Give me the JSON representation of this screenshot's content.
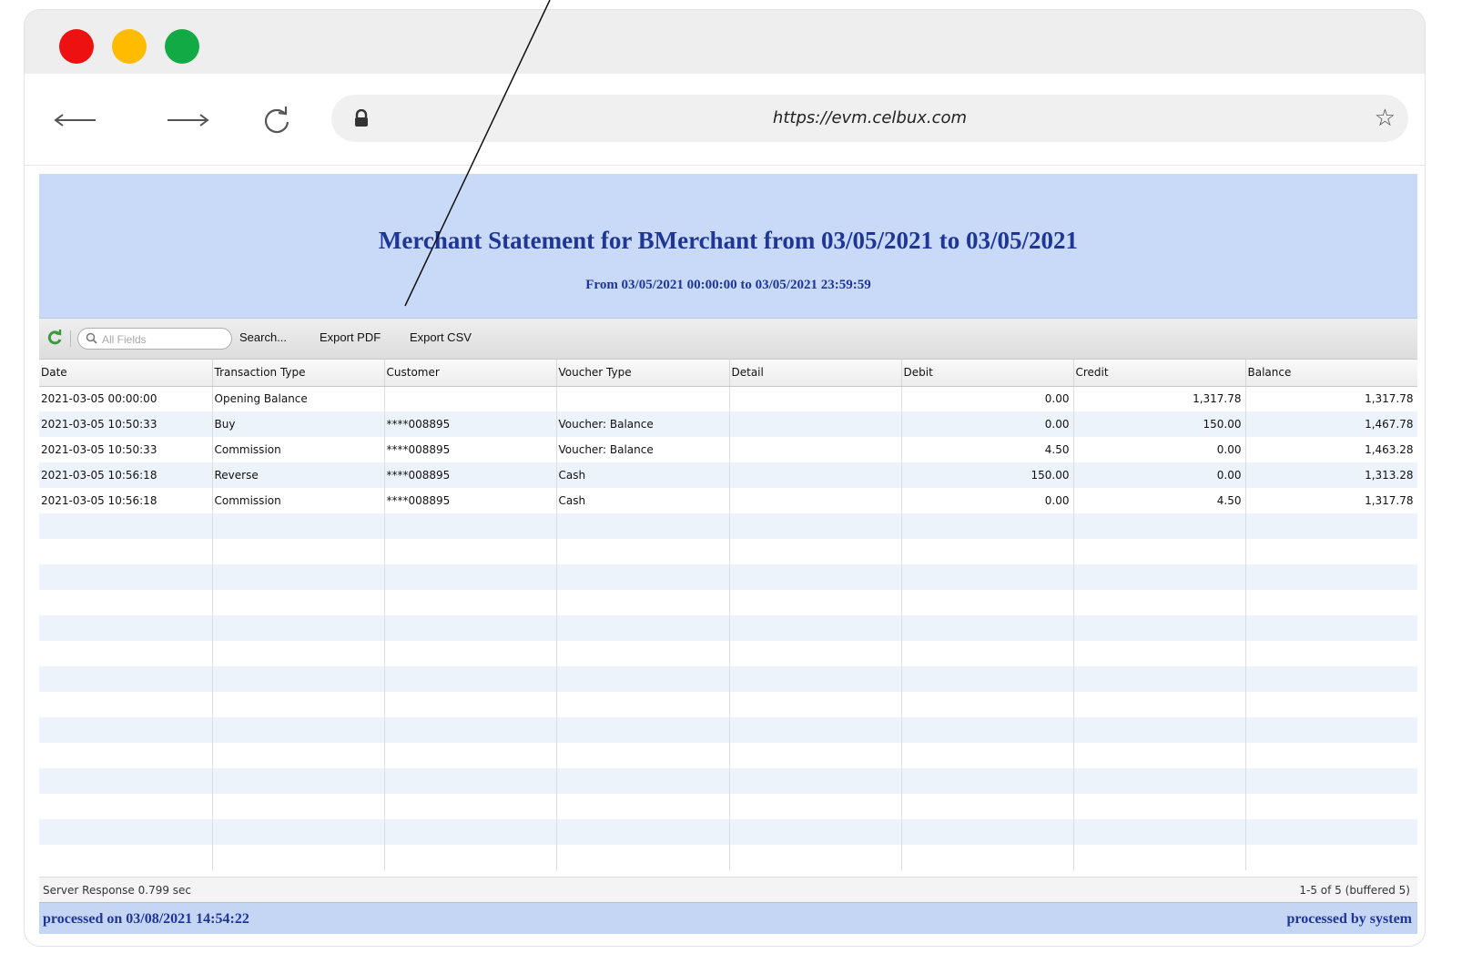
{
  "browser": {
    "url": "https://evm.celbux.com",
    "icons": {
      "back": "arrow-left-icon",
      "forward": "arrow-right-icon",
      "reload": "reload-icon",
      "lock": "lock-icon",
      "bookmark": "star-icon"
    },
    "bookmark_glyph": "☆"
  },
  "banner": {
    "title": "Merchant Statement for BMerchant from 03/05/2021 to 03/05/2021",
    "subtitle": "From 03/05/2021 00:00:00 to 03/05/2021 23:59:59"
  },
  "toolbar": {
    "search_placeholder": "All Fields",
    "search_label": "Search...",
    "export_pdf_label": "Export PDF",
    "export_csv_label": "Export CSV"
  },
  "table": {
    "columns": [
      "Date",
      "Transaction Type",
      "Customer",
      "Voucher Type",
      "Detail",
      "Debit",
      "Credit",
      "Balance"
    ],
    "rows": [
      [
        "2021-03-05 00:00:00",
        "Opening Balance",
        "",
        "",
        "",
        "0.00",
        "1,317.78",
        "1,317.78"
      ],
      [
        "2021-03-05 10:50:33",
        "Buy",
        "****008895",
        "Voucher: Balance",
        "",
        "0.00",
        "150.00",
        "1,467.78"
      ],
      [
        "2021-03-05 10:50:33",
        "Commission",
        "****008895",
        "Voucher: Balance",
        "",
        "4.50",
        "0.00",
        "1,463.28"
      ],
      [
        "2021-03-05 10:56:18",
        "Reverse",
        "****008895",
        "Cash",
        "",
        "150.00",
        "0.00",
        "1,313.28"
      ],
      [
        "2021-03-05 10:56:18",
        "Commission",
        "****008895",
        "Cash",
        "",
        "0.00",
        "4.50",
        "1,317.78"
      ]
    ],
    "empty_row_count": 14
  },
  "status": {
    "server_response": "Server Response 0.799 sec",
    "paging": "1-5 of 5 (buffered 5)"
  },
  "footer": {
    "processed_on": "processed on 03/08/2021 14:54:22",
    "processed_by": "processed by system"
  },
  "colors": {
    "banner_bg": "#c8daf7",
    "title_text": "#1f3694",
    "traffic_red": "#ee1111",
    "traffic_yellow": "#ffbb00",
    "traffic_green": "#11aa44",
    "row_stripe": "#edf3fb"
  }
}
